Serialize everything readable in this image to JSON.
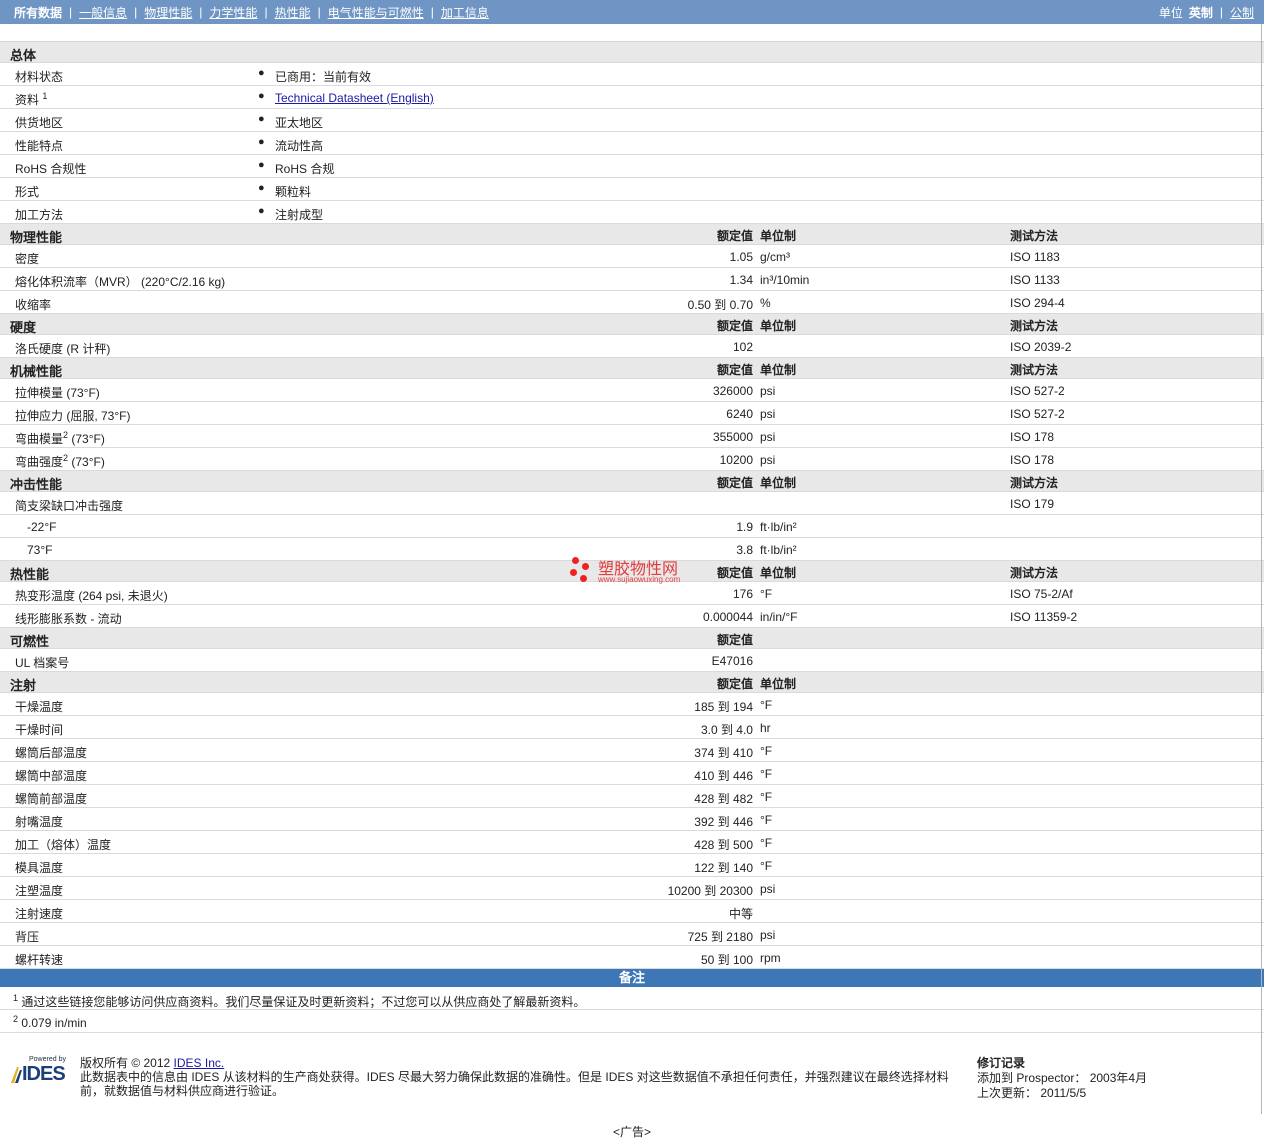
{
  "nav": {
    "tabs": [
      "所有数据",
      "一般信息",
      "物理性能",
      "力学性能",
      "热性能",
      "电气性能与可燃性",
      "加工信息"
    ],
    "units_label": "单位",
    "units": [
      "英制",
      "公制"
    ]
  },
  "headers": {
    "value": "额定值",
    "unit": "单位制",
    "method": "测试方法"
  },
  "general": {
    "title": "总体",
    "rows": [
      {
        "label": "材料状态",
        "value": "已商用：当前有效"
      },
      {
        "label": "资料",
        "sup": "1",
        "value": "Technical Datasheet (English)",
        "link": true
      },
      {
        "label": "供货地区",
        "value": "亚太地区"
      },
      {
        "label": "性能特点",
        "value": "流动性高"
      },
      {
        "label": "RoHS 合规性",
        "value": "RoHS 合规"
      },
      {
        "label": "形式",
        "value": "颗粒料"
      },
      {
        "label": "加工方法",
        "value": "注射成型"
      }
    ]
  },
  "sections": [
    {
      "title": "物理性能",
      "method": true,
      "rows": [
        {
          "label": "密度",
          "value": "1.05",
          "unit": "g/cm³",
          "method": "ISO 1183"
        },
        {
          "label": "熔化体积流率（MVR） (220°C/2.16 kg)",
          "value": "1.34",
          "unit": "in³/10min",
          "method": "ISO 1133"
        },
        {
          "label": "收缩率",
          "value": "0.50 到  0.70",
          "unit": "%",
          "method": "ISO 294-4"
        }
      ]
    },
    {
      "title": "硬度",
      "method": true,
      "rows": [
        {
          "label": "洛氏硬度 (R 计秤)",
          "value": "102",
          "unit": "",
          "method": "ISO 2039-2"
        }
      ]
    },
    {
      "title": "机械性能",
      "method": true,
      "rows": [
        {
          "label": "拉伸模量 (73°F)",
          "value": "326000",
          "unit": "psi",
          "method": "ISO 527-2"
        },
        {
          "label": "拉伸应力 (屈服, 73°F)",
          "value": "6240",
          "unit": "psi",
          "method": "ISO 527-2"
        },
        {
          "label": "弯曲模量",
          "sup": "2",
          "label2": " (73°F)",
          "value": "355000",
          "unit": "psi",
          "method": "ISO 178"
        },
        {
          "label": "弯曲强度",
          "sup": "2",
          "label2": " (73°F)",
          "value": "10200",
          "unit": "psi",
          "method": "ISO 178"
        }
      ]
    },
    {
      "title": "冲击性能",
      "method": true,
      "rows": [
        {
          "label": "简支梁缺口冲击强度",
          "value": "",
          "unit": "",
          "method": "ISO 179"
        },
        {
          "label": "-22°F",
          "indent": true,
          "value": "1.9",
          "unit": "ft·lb/in²",
          "method": ""
        },
        {
          "label": "73°F",
          "indent": true,
          "value": "3.8",
          "unit": "ft·lb/in²",
          "method": ""
        }
      ]
    },
    {
      "title": "热性能",
      "method": true,
      "rows": [
        {
          "label": "热变形温度 (264 psi, 未退火)",
          "value": "176",
          "unit": "°F",
          "method": "ISO 75-2/Af"
        },
        {
          "label": "线形膨胀系数 - 流动",
          "value": "0.000044",
          "unit": "in/in/°F",
          "method": "ISO 11359-2"
        }
      ]
    },
    {
      "title": "可燃性",
      "nounit": true,
      "rows": [
        {
          "label": "UL 档案号",
          "value": "E47016",
          "unit": "",
          "method": ""
        }
      ]
    },
    {
      "title": "注射",
      "method": false,
      "rows": [
        {
          "label": "干燥温度",
          "value": "185 到  194",
          "unit": "°F"
        },
        {
          "label": "干燥时间",
          "value": "3.0 到  4.0",
          "unit": "hr"
        },
        {
          "label": "螺筒后部温度",
          "value": "374 到  410",
          "unit": "°F"
        },
        {
          "label": "螺筒中部温度",
          "value": "410 到  446",
          "unit": "°F"
        },
        {
          "label": "螺筒前部温度",
          "value": "428 到  482",
          "unit": "°F"
        },
        {
          "label": "射嘴温度",
          "value": "392 到  446",
          "unit": "°F"
        },
        {
          "label": "加工（熔体）温度",
          "value": "428 到  500",
          "unit": "°F"
        },
        {
          "label": "模具温度",
          "value": "122 到  140",
          "unit": "°F"
        },
        {
          "label": "注塑温度",
          "value": "10200 到  20300",
          "unit": "psi"
        },
        {
          "label": "注射速度",
          "value": "中等",
          "unit": ""
        },
        {
          "label": "背压",
          "value": "725 到  2180",
          "unit": "psi"
        },
        {
          "label": "螺杆转速",
          "value": "50 到  100",
          "unit": "rpm"
        }
      ]
    }
  ],
  "notes": {
    "title": "备注",
    "items": [
      {
        "num": "1",
        "text": "通过这些链接您能够访问供应商资料。我们尽量保证及时更新资料；不过您可以从供应商处了解最新资料。"
      },
      {
        "num": "2",
        "text": "0.079 in/min"
      }
    ]
  },
  "footer": {
    "powered_by": "Powered by",
    "logo_text": "IDES",
    "copyright_prefix": "版权所有 © 2012 ",
    "copyright_link": "IDES Inc.",
    "disclaimer": "此数据表中的信息由 IDES 从该材料的生产商处获得。IDES 尽最大努力确保此数据的准确性。但是 IDES 对这些数据值不承担任何责任，并强烈建议在最终选择材料前，就数据值与材料供应商进行验证。",
    "rev_title": "修订记录",
    "added": "添加到 Prospector： 2003年4月",
    "updated": "上次更新： 2011/5/5"
  },
  "ad": "<广告>",
  "watermark": {
    "brand": "塑胶物性网",
    "url": "www.sujiaowuxing.com"
  }
}
